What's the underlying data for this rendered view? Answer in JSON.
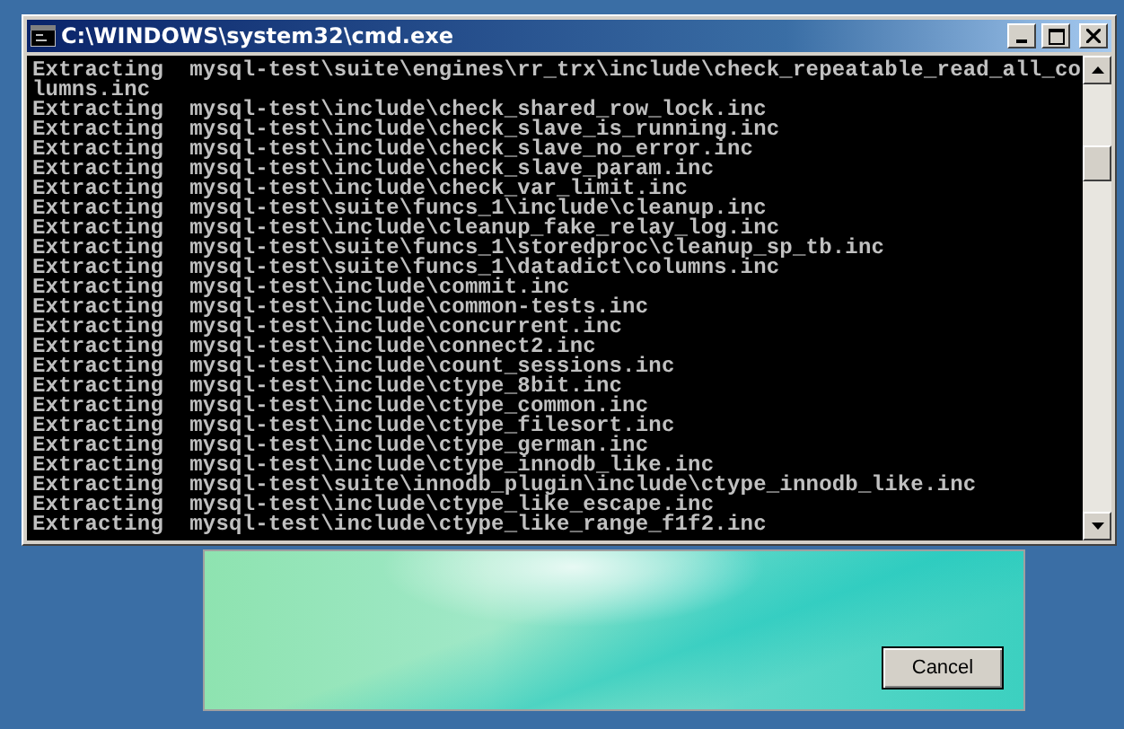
{
  "window": {
    "title": "C:\\WINDOWS\\system32\\cmd.exe"
  },
  "console": {
    "lines": [
      "Extracting  mysql-test\\suite\\engines\\rr_trx\\include\\check_repeatable_read_all_co",
      "lumns.inc",
      "Extracting  mysql-test\\include\\check_shared_row_lock.inc",
      "Extracting  mysql-test\\include\\check_slave_is_running.inc",
      "Extracting  mysql-test\\include\\check_slave_no_error.inc",
      "Extracting  mysql-test\\include\\check_slave_param.inc",
      "Extracting  mysql-test\\include\\check_var_limit.inc",
      "Extracting  mysql-test\\suite\\funcs_1\\include\\cleanup.inc",
      "Extracting  mysql-test\\include\\cleanup_fake_relay_log.inc",
      "Extracting  mysql-test\\suite\\funcs_1\\storedproc\\cleanup_sp_tb.inc",
      "Extracting  mysql-test\\suite\\funcs_1\\datadict\\columns.inc",
      "Extracting  mysql-test\\include\\commit.inc",
      "Extracting  mysql-test\\include\\common-tests.inc",
      "Extracting  mysql-test\\include\\concurrent.inc",
      "Extracting  mysql-test\\include\\connect2.inc",
      "Extracting  mysql-test\\include\\count_sessions.inc",
      "Extracting  mysql-test\\include\\ctype_8bit.inc",
      "Extracting  mysql-test\\include\\ctype_common.inc",
      "Extracting  mysql-test\\include\\ctype_filesort.inc",
      "Extracting  mysql-test\\include\\ctype_german.inc",
      "Extracting  mysql-test\\include\\ctype_innodb_like.inc",
      "Extracting  mysql-test\\suite\\innodb_plugin\\include\\ctype_innodb_like.inc",
      "Extracting  mysql-test\\include\\ctype_like_escape.inc",
      "Extracting  mysql-test\\include\\ctype_like_range_f1f2.inc"
    ]
  },
  "installer": {
    "cancel_button": "Cancel"
  }
}
